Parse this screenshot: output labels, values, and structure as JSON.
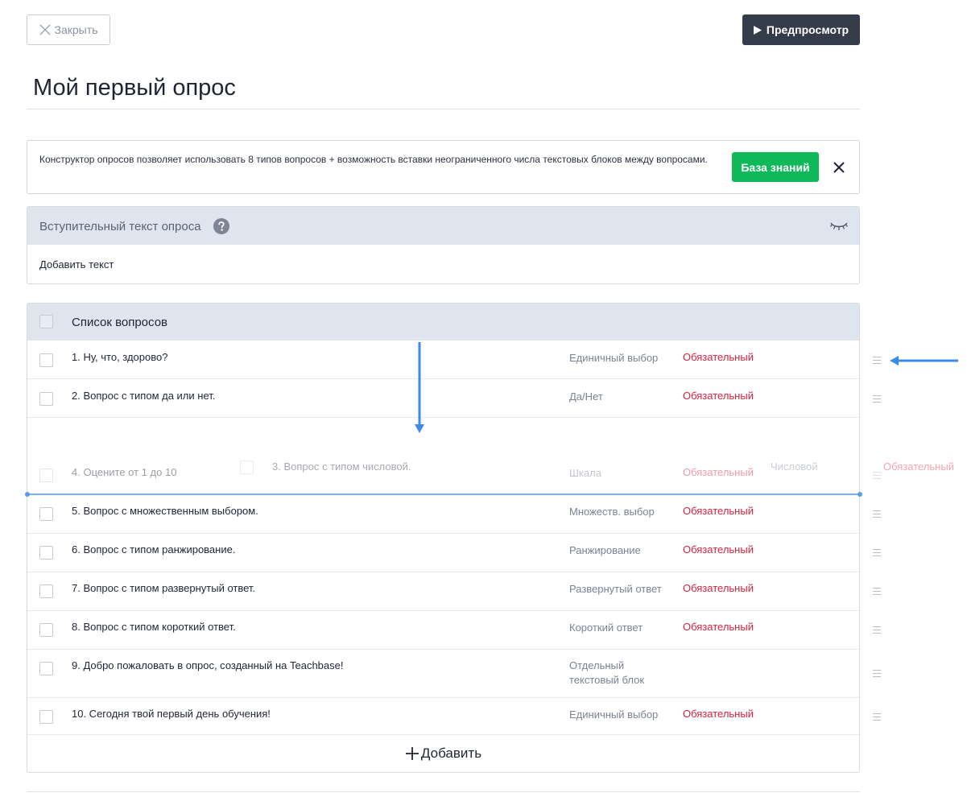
{
  "toolbar": {
    "close_label": "Закрыть",
    "preview_label": "Предпросмотр"
  },
  "survey": {
    "title": "Мой первый опрос"
  },
  "info": {
    "text": "Конструктор опросов позволяет использовать 8 типов вопросов + возможность вставки неограниченного числа текстовых блоков между вопросами.",
    "kb_label": "База знаний"
  },
  "intro": {
    "title": "Вступительный текст опроса",
    "add_text": "Добавить текст"
  },
  "questions": {
    "header": "Список вопросов",
    "items": [
      {
        "label": "1. Ну, что, здорово?",
        "type": "Единичный выбор",
        "required": "Обязательный"
      },
      {
        "label": "2. Вопрос с типом да или нет.",
        "type": "Да/Нет",
        "required": "Обязательный"
      },
      {
        "label": "4. Оцените от 1 до 10",
        "type": "Шкала",
        "required": "Обязательный"
      },
      {
        "label": "5. Вопрос с множественным выбором.",
        "type": "Множеств. выбор",
        "required": "Обязательный"
      },
      {
        "label": "6. Вопрос с типом ранжирование.",
        "type": "Ранжирование",
        "required": "Обязательный"
      },
      {
        "label": "7. Вопрос с типом развернутый ответ.",
        "type": "Развернутый ответ",
        "required": "Обязательный"
      },
      {
        "label": "8. Вопрос с типом короткий ответ.",
        "type": "Короткий ответ",
        "required": "Обязательный"
      },
      {
        "label": "9. Добро пожаловать в опрос, созданный на Teachbase!",
        "type": "Отдельный текстовый блок",
        "required": ""
      },
      {
        "label": "10. Сегодня твой первый день обучения!",
        "type": "Единичный выбор",
        "required": "Обязательный"
      }
    ],
    "dragging": {
      "label": "3. Вопрос с типом числовой.",
      "type": "Числовой",
      "required": "Обязательный"
    },
    "add_label": "Добавить"
  },
  "icons": {
    "close": "close-x-icon",
    "preview": "play-icon",
    "help": "question-circle-icon",
    "visibility": "eye-closed-icon",
    "drag": "drag-handle-icon",
    "add": "plus-icon"
  },
  "colors": {
    "accent_green": "#0fb858",
    "dark_button": "#343c4a",
    "required_red": "#d9213e",
    "header_bg": "#dfe5ee",
    "annotation_blue": "#3d8be4"
  }
}
